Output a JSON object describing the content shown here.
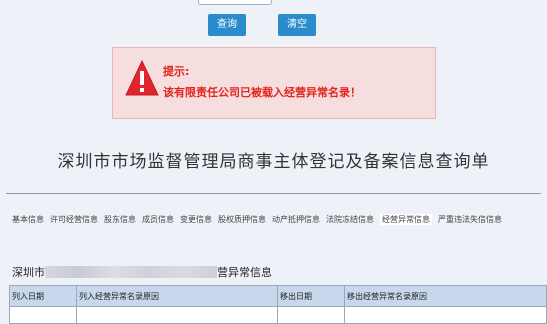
{
  "buttons": {
    "query": "查询",
    "clear": "清空"
  },
  "alert": {
    "title": "提示:",
    "message": "该有限责任公司已被载入经营异常名录！"
  },
  "page_title": "深圳市市场监督管理局商事主体登记及备案信息查询单",
  "tabs": [
    "基本信息",
    "许可经营信息",
    "股东信息",
    "成员信息",
    "变更信息",
    "股权质押信息",
    "动产抵押信息",
    "法院冻结信息",
    "经营异常信息",
    "严重违法失信信息"
  ],
  "active_tab": "经营异常信息",
  "section": {
    "prefix": "深圳市",
    "suffix": "营异常信息"
  },
  "table": {
    "headers": [
      "列入日期",
      "列入经营异常名录原因",
      "移出日期",
      "移出经营异常名录原因"
    ]
  }
}
